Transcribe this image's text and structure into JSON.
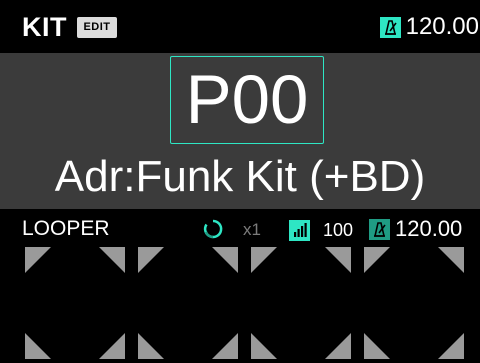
{
  "header": {
    "mode_label": "KIT",
    "edit_badge": "EDIT",
    "tempo": "120.00",
    "tempo_icon": "metronome-icon"
  },
  "preset": {
    "number": "P00",
    "name": "Adr:Funk Kit (+BD)"
  },
  "looper": {
    "label": "LOOPER",
    "loop_icon": "loop-icon",
    "multiplier": "x1",
    "volume_icon": "volume-bars-icon",
    "volume": "100",
    "tempo_icon": "metronome-icon",
    "tempo": "120.00",
    "pads": [
      "pad-1",
      "pad-2",
      "pad-3",
      "pad-4"
    ]
  },
  "colors": {
    "accent": "#2ee6c4",
    "accent_dim": "#1f9c84",
    "panel": "#3b3b3b",
    "background": "#000000",
    "pad_corner": "#9a9a9a",
    "muted_text": "#7b7b7b"
  }
}
